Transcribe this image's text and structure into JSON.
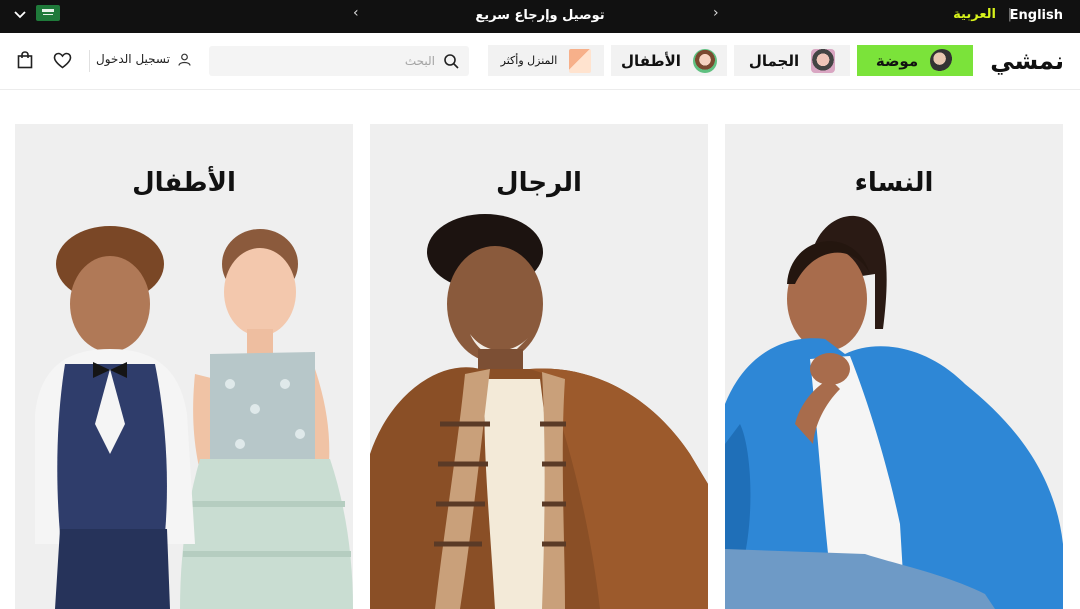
{
  "topbar": {
    "lang_english": "English",
    "separator": "|",
    "lang_arabic": "العربية",
    "promo_text": "توصيل وإرجاع سريع",
    "prev_arrow": "‹",
    "next_arrow": "›",
    "country_flag": "saudi-arabia-flag-icon"
  },
  "nav": {
    "logo": "نمشي",
    "categories": [
      {
        "label": "موضة",
        "icon": "fashion-thumb"
      },
      {
        "label": "الجمال",
        "icon": "beauty-thumb"
      },
      {
        "label": "الأطفال",
        "icon": "kids-thumb"
      },
      {
        "label": "المنزل وأكثر",
        "icon": "home-thumb"
      }
    ],
    "search_placeholder": "البحث",
    "login_label": "تسجيل الدخول"
  },
  "cards": [
    {
      "title": "النساء"
    },
    {
      "title": "الرجال"
    },
    {
      "title": "الأطفال"
    }
  ],
  "colors": {
    "accent_green": "#7be33a",
    "lime_text": "#d7f21b",
    "topbar_bg": "#111111",
    "card_bg": "#efefef"
  }
}
